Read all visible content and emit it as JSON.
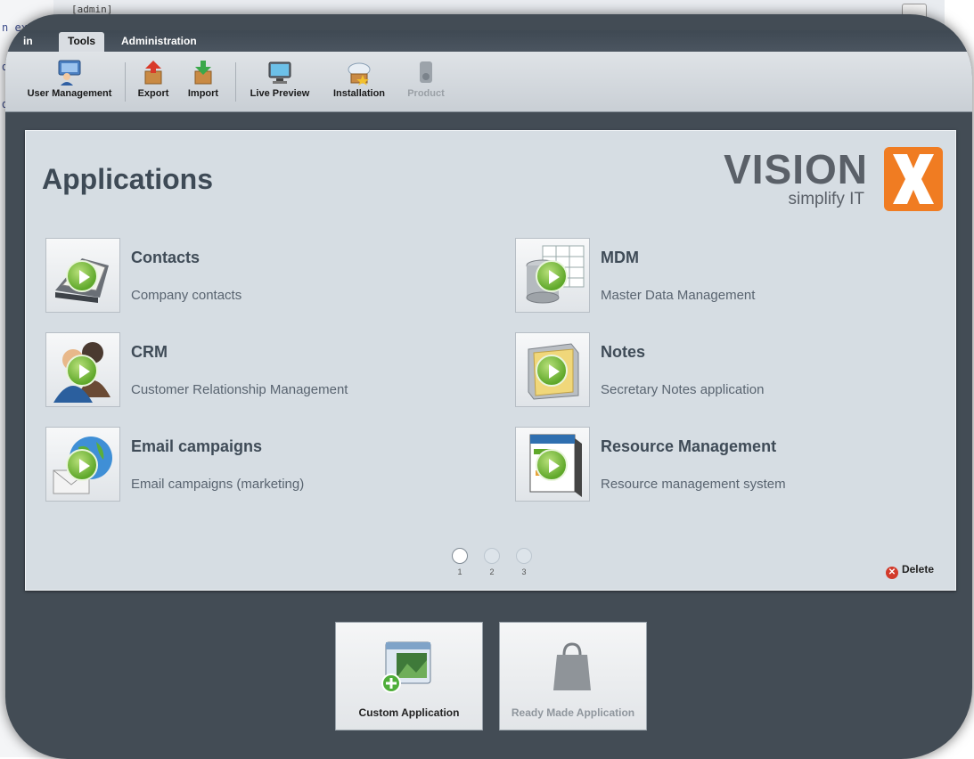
{
  "background": {
    "code_fragments": [
      "n exce",
      "de",
      "d"
    ],
    "window_title": "[admin]"
  },
  "tabs": [
    {
      "label": "in",
      "active": false
    },
    {
      "label": "Tools",
      "active": true
    },
    {
      "label": "Administration",
      "active": false
    }
  ],
  "toolbar": {
    "items": [
      {
        "label": "User Management",
        "icon": "users-icon",
        "disabled": false
      },
      {
        "label": "Export",
        "icon": "export-icon",
        "disabled": false
      },
      {
        "label": "Import",
        "icon": "import-icon",
        "disabled": false
      },
      {
        "label": "Live Preview",
        "icon": "monitor-icon",
        "disabled": false
      },
      {
        "label": "Installation",
        "icon": "cloud-install-icon",
        "disabled": false
      },
      {
        "label": "Product",
        "icon": "product-icon",
        "disabled": true
      }
    ]
  },
  "panel": {
    "title": "Applications",
    "logo": {
      "word": "VISION",
      "letter": "X",
      "tagline": "simplify IT"
    },
    "apps": [
      {
        "name": "Contacts",
        "description": "Company contacts",
        "icon": "contacts-icon"
      },
      {
        "name": "MDM",
        "description": "Master Data Management",
        "icon": "database-icon"
      },
      {
        "name": "CRM",
        "description": "Customer Relationship Management",
        "icon": "people-icon"
      },
      {
        "name": "Notes",
        "description": "Secretary Notes application",
        "icon": "notes-icon"
      },
      {
        "name": "Email campaigns",
        "description": "Email campaigns (marketing)",
        "icon": "email-globe-icon"
      },
      {
        "name": "Resource Management",
        "description": "Resource management system",
        "icon": "resource-icon"
      }
    ],
    "pager": {
      "pages": [
        "1",
        "2",
        "3"
      ],
      "current": "1"
    },
    "delete_label": "Delete"
  },
  "bottom_buttons": [
    {
      "label": "Custom Application",
      "icon": "custom-app-icon",
      "disabled": false
    },
    {
      "label": "Ready Made Application",
      "icon": "shopping-bag-icon",
      "disabled": true
    }
  ],
  "colors": {
    "accent": "#f07c22",
    "play_green": "#5fa82a",
    "panel_bg": "#d6dde3",
    "frame_bg": "#434c55"
  }
}
